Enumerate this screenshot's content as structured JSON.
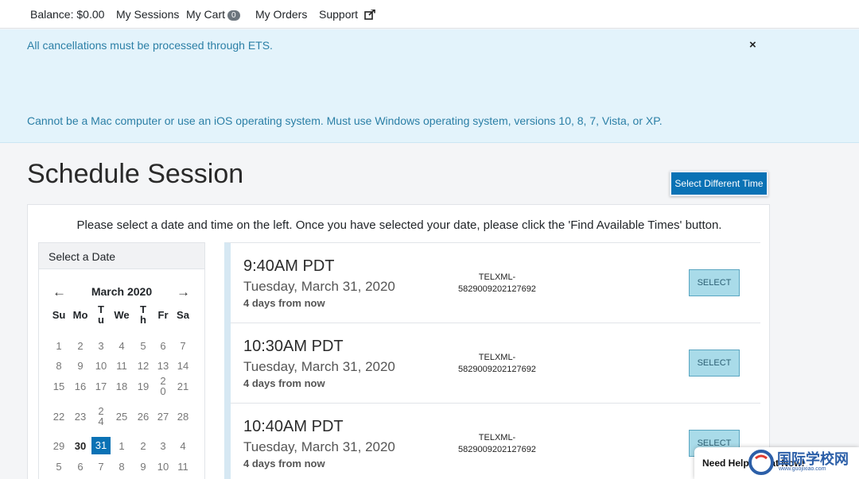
{
  "nav": {
    "balance": "Balance: $0.00",
    "sessions": "My Sessions",
    "cart": "My Cart",
    "cart_count": "0",
    "orders": "My Orders",
    "support": "Support"
  },
  "alert": {
    "line1": "All cancellations must be processed through ETS.",
    "line2": "Cannot be a Mac computer or use an iOS operating system. Must use Windows operating system, versions 10, 8, 7, Vista, or XP.",
    "close": "×"
  },
  "page": {
    "title": "Schedule Session",
    "different_time_label": "Select Different Time",
    "instructions": "Please select a date and time on the left. Once you have selected your date, please click the 'Find Available Times' button."
  },
  "calendar": {
    "header": "Select a Date",
    "prev": "←",
    "next": "→",
    "month": "March 2020",
    "dow": [
      "Su",
      "Mo",
      "T\nu",
      "We",
      "T\nh",
      "Fr",
      "Sa"
    ],
    "weeks": [
      [
        "1",
        "2",
        "3",
        "4",
        "5",
        "6",
        "7"
      ],
      [
        "8",
        "9",
        "10",
        "11",
        "12",
        "13",
        "14"
      ],
      [
        "15",
        "16",
        "17",
        "18",
        "19",
        "2\n0",
        "21"
      ],
      [
        "22",
        "23",
        "2\n4",
        "25",
        "26",
        "27",
        "28"
      ],
      [
        "29",
        "30",
        "31",
        "1",
        "2",
        "3",
        "4"
      ],
      [
        "5",
        "6",
        "7",
        "8",
        "9",
        "10",
        "11"
      ]
    ],
    "today": "30",
    "selected": "31",
    "selected_color": "#0a72b5"
  },
  "slots": [
    {
      "time": "9:40AM PDT",
      "date": "Tuesday, March 31, 2020",
      "relative": "4 days from now",
      "code_line1": "TELXML-",
      "code_line2": "5829009202127692",
      "button": "SELECT"
    },
    {
      "time": "10:30AM PDT",
      "date": "Tuesday, March 31, 2020",
      "relative": "4 days from now",
      "code_line1": "TELXML-",
      "code_line2": "5829009202127692",
      "button": "SELECT"
    },
    {
      "time": "10:40AM PDT",
      "date": "Tuesday, March 31, 2020",
      "relative": "4 days from now",
      "code_line1": "TELXML-",
      "code_line2": "5829009202127692",
      "button": "SELECT"
    }
  ],
  "help": {
    "label": "Need Help? Chat Now!",
    "watermark": "国际学校网",
    "watermark_sub": "www.guojixiao.com"
  },
  "icons": {
    "external_link": "external-link-icon",
    "close": "close-icon",
    "prev": "arrow-left-icon",
    "next": "arrow-right-icon",
    "chat": "chat-icon"
  }
}
